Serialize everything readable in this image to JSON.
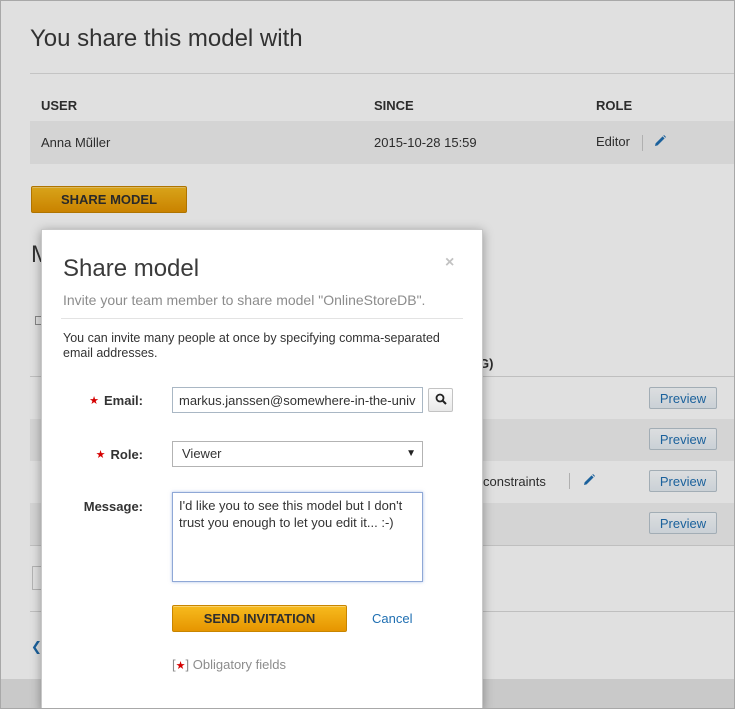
{
  "shares": {
    "title": "You share this model with",
    "columns": [
      "USER",
      "SINCE",
      "ROLE"
    ],
    "rows": [
      {
        "user": "Anna Mũller",
        "since": "2015-10-28 15:59",
        "role": "Editor"
      }
    ],
    "share_button": "SHARE MODEL"
  },
  "background": {
    "heading_fragment": "M",
    "header_fragment": "G)",
    "constraints_text": "constraints",
    "preview_label": "Preview"
  },
  "modal": {
    "close_icon": "×",
    "title": "Share model",
    "subtitle": "Invite your team member to share model \"OnlineStoreDB\".",
    "help": "You can invite many people at once by specifying comma-separated email addresses.",
    "email_label": "Email:",
    "email_value": "markus.janssen@somewhere-in-the-universe.com",
    "role_label": "Role:",
    "role_value": "Viewer",
    "message_label": "Message:",
    "message_value": "I'd like you to see this model but I don't trust you enough to let you edit it... :-)",
    "send_button": "SEND INVITATION",
    "cancel": "Cancel",
    "obligatory_open": "[",
    "obligatory_star": "★",
    "obligatory_close": "]",
    "obligatory_text": "Obligatory fields"
  },
  "colors": {
    "accent_orange": "#f0a800",
    "link_blue": "#1f6fb2",
    "required_red": "#d50000"
  }
}
